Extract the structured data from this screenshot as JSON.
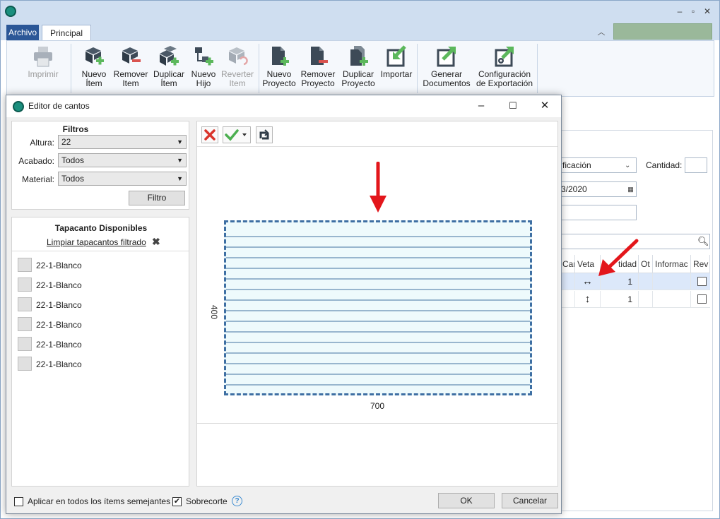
{
  "window": {
    "minimize_glyph": "‒",
    "restore_glyph": "▫",
    "close_glyph": "✕"
  },
  "tabs": {
    "archivo": "Archivo",
    "principal": "Principal"
  },
  "ribbon": {
    "imprimir": "Imprimir",
    "nuevo_item": [
      "Nuevo",
      "Ítem"
    ],
    "remover_item": [
      "Remover",
      "Item"
    ],
    "duplicar_item": [
      "Duplicar",
      "Ítem"
    ],
    "nuevo_hijo": [
      "Nuevo",
      "Hijo"
    ],
    "reverter_item": [
      "Reverter",
      "Item"
    ],
    "nuevo_proyecto": [
      "Nuevo",
      "Proyecto"
    ],
    "remover_proyecto": [
      "Remover",
      "Proyecto"
    ],
    "duplicar_proyecto": [
      "Duplicar",
      "Proyecto"
    ],
    "importar": "Importar",
    "generar_documentos": [
      "Generar",
      "Documentos"
    ],
    "config_exportacion": [
      "Configuración",
      "de Exportación"
    ]
  },
  "background": {
    "select_value": "ficación",
    "cantidad_label": "Cantidad:",
    "date_value": "3/2020",
    "grid_headers": [
      "Cant",
      "Veta",
      "tidad",
      "Ot",
      "Informac",
      "Rev"
    ],
    "rows": [
      {
        "veta": "↔",
        "cantidad": "1"
      },
      {
        "veta": "↕",
        "cantidad": "1"
      }
    ]
  },
  "dialog": {
    "title": "Editor de cantos",
    "filters": {
      "title": "Filtros",
      "altura_label": "Altura:",
      "altura_value": "22",
      "acabado_label": "Acabado:",
      "acabado_value": "Todos",
      "material_label": "Material:",
      "material_value": "Todos",
      "filter_button": "Filtro"
    },
    "available": {
      "title": "Tapacanto Disponibles",
      "clear_link": "Limpiar tapacantos filtrado",
      "items": [
        "22-1-Blanco",
        "22-1-Blanco",
        "22-1-Blanco",
        "22-1-Blanco",
        "22-1-Blanco",
        "22-1-Blanco"
      ]
    },
    "canvas": {
      "width_value": "700",
      "height_value": "400"
    },
    "footer": {
      "apply_all_label": "Aplicar en todos los ítems semejantes",
      "apply_all_checked": false,
      "sobrecorte_label": "Sobrecorte",
      "sobrecorte_checked": true,
      "ok_button": "OK",
      "cancel_button": "Cancelar"
    }
  },
  "colors": {
    "accent": "#2b5797",
    "panel_fill": "#eefafc",
    "panel_border": "#3e6fa3",
    "arrow": "#e3161b",
    "green": "#5cb85c"
  }
}
